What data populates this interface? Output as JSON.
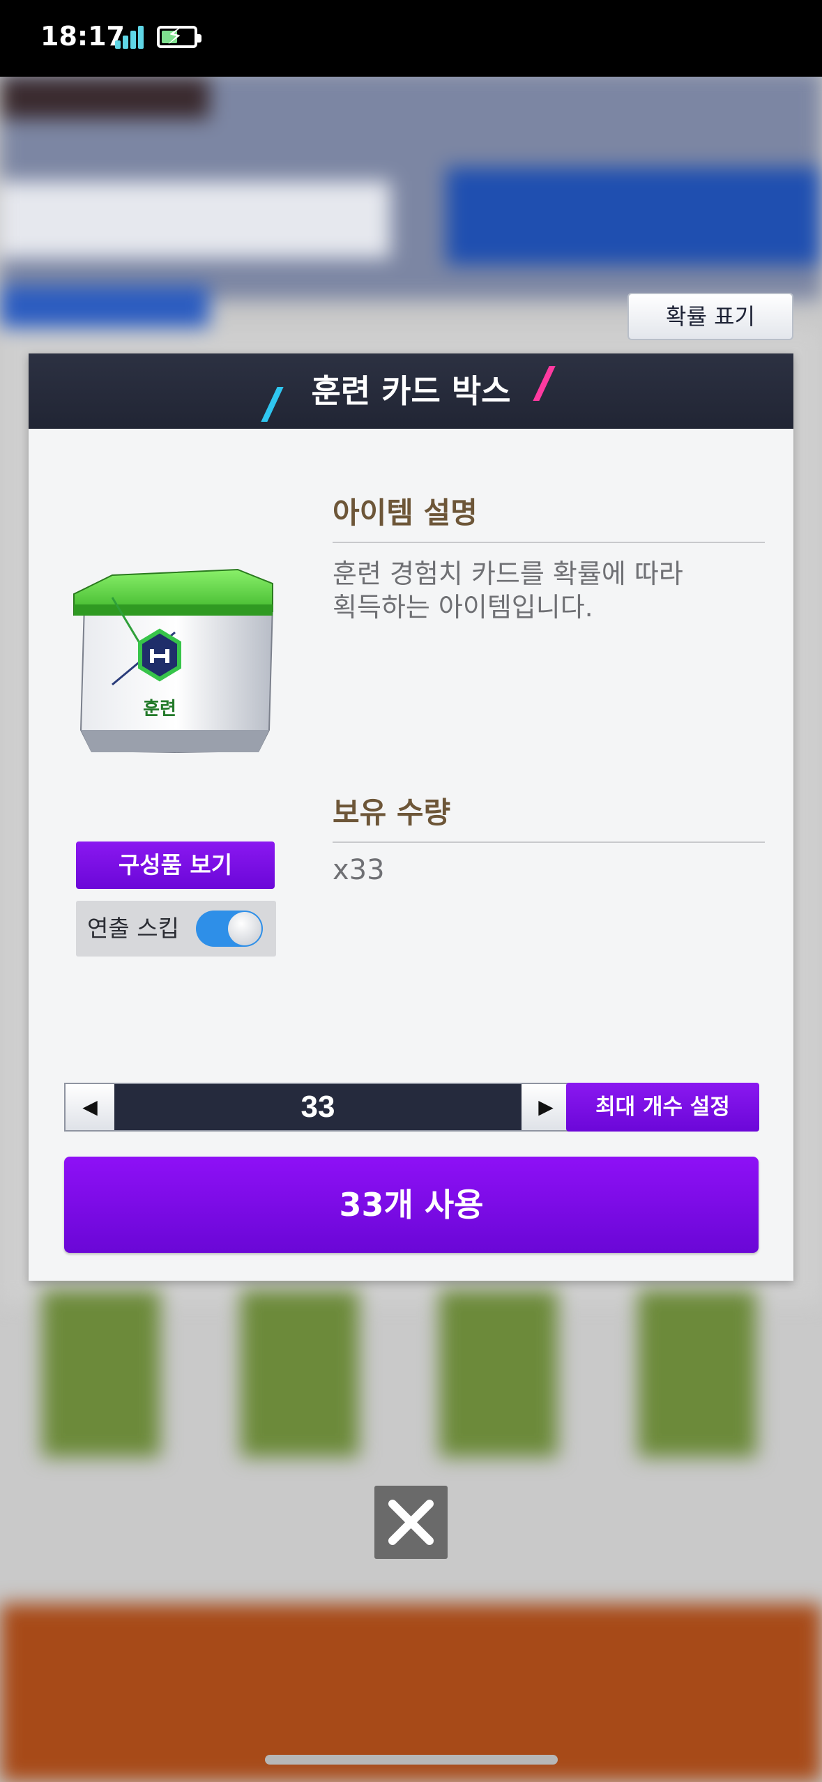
{
  "status_bar": {
    "time": "18:17"
  },
  "probability_button": {
    "label": "확률 표기"
  },
  "dialog": {
    "title": "훈련 카드 박스",
    "item_image": {
      "icon": "training-card-box",
      "badge_text": "훈련"
    },
    "description_section": {
      "label": "아이템 설명",
      "lines": [
        "훈련 경험치 카드를 확률에 따라",
        "획득하는 아이템입니다."
      ]
    },
    "owned_section": {
      "label": "보유 수량",
      "value": "x33"
    },
    "components_button": {
      "label": "구성품 보기"
    },
    "skip_animation": {
      "label": "연출 스킵",
      "enabled": true
    },
    "quantity_stepper": {
      "value": "33",
      "decrease_icon": "triangle-left",
      "increase_icon": "triangle-right"
    },
    "max_button": {
      "label": "최대 개수 설정"
    },
    "use_button": {
      "label": "33개 사용"
    }
  },
  "close_button": {
    "icon": "close-x"
  },
  "colors": {
    "accent_purple": "#7a0ee6",
    "header_navy": "#262b3b",
    "toggle_blue": "#2e8fe8"
  }
}
